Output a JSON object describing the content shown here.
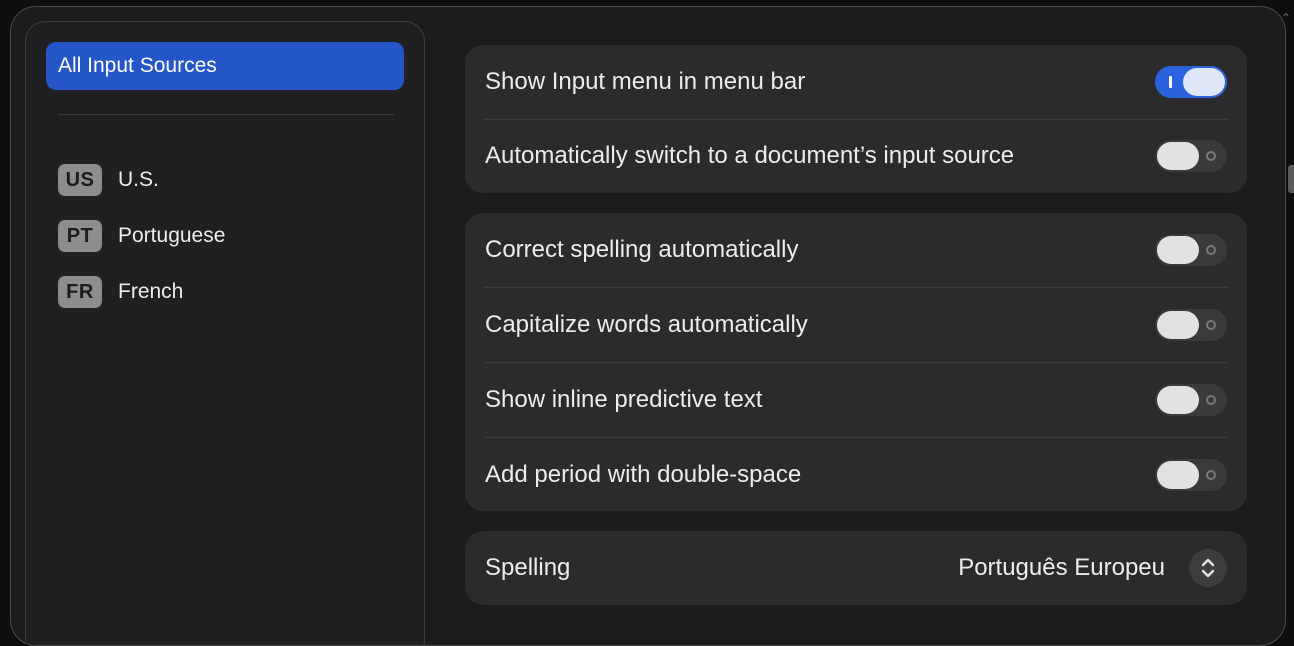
{
  "sidebar": {
    "selected_label": "All Input Sources",
    "sources": [
      {
        "badge": "US",
        "label": "U.S."
      },
      {
        "badge": "PT",
        "label": "Portuguese"
      },
      {
        "badge": "FR",
        "label": "French"
      }
    ]
  },
  "group1": {
    "show_input_menu": {
      "label": "Show Input menu in menu bar",
      "state": "on"
    },
    "auto_switch": {
      "label": "Automatically switch to a document’s input source",
      "state": "off"
    }
  },
  "group2": {
    "correct_spelling": {
      "label": "Correct spelling automatically",
      "state": "off"
    },
    "capitalize_words": {
      "label": "Capitalize words automatically",
      "state": "off"
    },
    "inline_predictive": {
      "label": "Show inline predictive text",
      "state": "off"
    },
    "add_period": {
      "label": "Add period with double-space",
      "state": "off"
    }
  },
  "group3": {
    "spelling": {
      "label": "Spelling",
      "value": "Português Europeu"
    }
  },
  "colors": {
    "accent": "#2456c8",
    "toggle_on": "#2a63dd",
    "background": "#1c1c1e",
    "panel": "#2b2b2d"
  }
}
